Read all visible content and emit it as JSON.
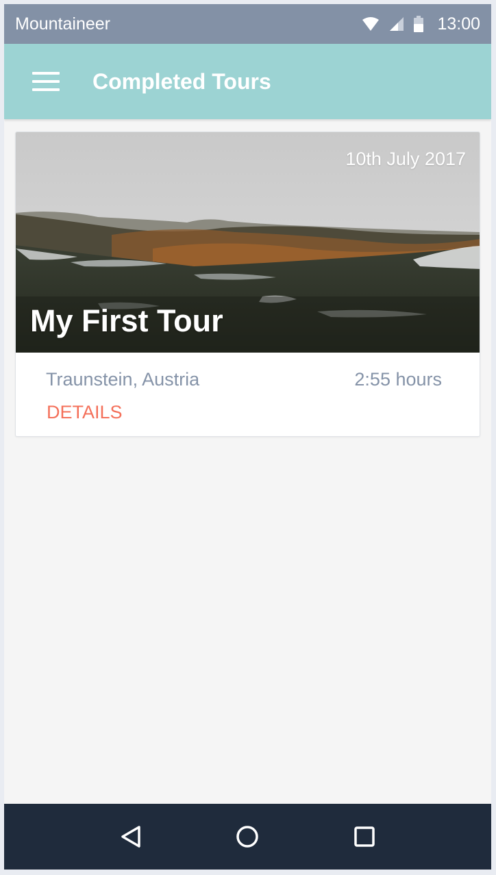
{
  "status_bar": {
    "app_name": "Mountaineer",
    "time": "13:00",
    "icons": [
      "wifi-icon",
      "cellular-signal-icon",
      "battery-icon"
    ]
  },
  "app_bar": {
    "title": "Completed Tours",
    "menu_icon": "hamburger-menu-icon",
    "color": "#9cd3d3"
  },
  "tours": [
    {
      "title": "My First Tour",
      "date": "10th July 2017",
      "location": "Traunstein, Austria",
      "duration": "2:55 hours",
      "details_label": "DETAILS"
    }
  ],
  "nav_bar": {
    "icons": [
      "back-triangle-icon",
      "home-circle-icon",
      "recents-square-icon"
    ]
  },
  "colors": {
    "status_bar": "#8391a6",
    "accent": "#f4705a",
    "secondary_text": "#8593a8",
    "nav_bar": "#1f2b3c"
  }
}
